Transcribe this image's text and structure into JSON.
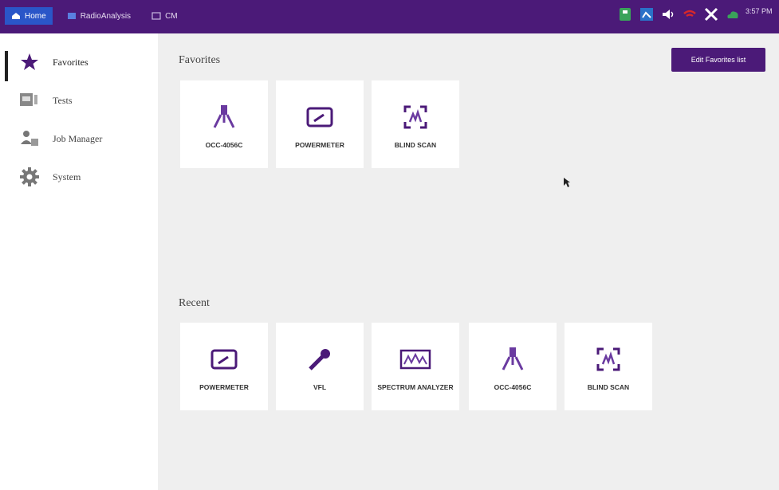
{
  "topbar": {
    "tabs": [
      {
        "label": "Home",
        "icon": "home-icon"
      },
      {
        "label": "RadioAnalysis",
        "icon": "radio-analysis-icon"
      },
      {
        "label": "CM",
        "icon": "cm-icon"
      }
    ],
    "status_icons": [
      "usb-icon",
      "network-icon",
      "volume-icon",
      "wifi-off-icon",
      "tools-icon",
      "cloud-icon"
    ],
    "clock": {
      "time": "3:57 PM"
    }
  },
  "sidebar": {
    "items": [
      {
        "label": "Favorites",
        "icon": "star-icon",
        "active": true
      },
      {
        "label": "Tests",
        "icon": "tests-icon",
        "active": false
      },
      {
        "label": "Job Manager",
        "icon": "job-manager-icon",
        "active": false
      },
      {
        "label": "System",
        "icon": "gear-icon",
        "active": false
      }
    ]
  },
  "favorites": {
    "title": "Favorites",
    "edit_button": "Edit Favorites list",
    "tiles": [
      {
        "label": "OCC-4056C",
        "icon": "occ-probe-icon"
      },
      {
        "label": "POWERMETER",
        "icon": "powermeter-icon"
      },
      {
        "label": "BLIND SCAN",
        "icon": "blind-scan-icon"
      }
    ]
  },
  "recent": {
    "title": "Recent",
    "tiles": [
      {
        "label": "POWERMETER",
        "icon": "powermeter-icon"
      },
      {
        "label": "VFL",
        "icon": "vfl-icon"
      },
      {
        "label": "SPECTRUM ANALYZER",
        "icon": "spectrum-analyzer-icon"
      },
      {
        "label": "OCC-4056C",
        "icon": "occ-probe-icon"
      },
      {
        "label": "BLIND SCAN",
        "icon": "blind-scan-icon"
      }
    ]
  },
  "colors": {
    "accent": "#4b1a78",
    "active_tab": "#2a56c8",
    "background": "#efefef"
  }
}
